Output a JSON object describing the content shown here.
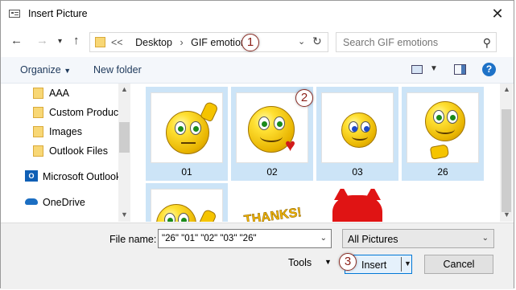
{
  "window": {
    "title": "Insert Picture"
  },
  "nav": {
    "breadcrumb": [
      "Desktop",
      "GIF emotions"
    ],
    "overflow": "<<",
    "search_placeholder": "Search GIF emotions"
  },
  "toolbar": {
    "organize_label": "Organize",
    "new_folder_label": "New folder"
  },
  "sidebar": {
    "items": [
      {
        "label": "AAA",
        "icon": "folder-icon"
      },
      {
        "label": "Custom Product",
        "icon": "folder-icon"
      },
      {
        "label": "Images",
        "icon": "folder-icon"
      },
      {
        "label": "Outlook Files",
        "icon": "folder-icon"
      },
      {
        "label": "Microsoft Outlook",
        "icon": "outlook-icon"
      },
      {
        "label": "OneDrive",
        "icon": "onedrive-icon"
      }
    ]
  },
  "files": [
    {
      "name": "01",
      "selected": true
    },
    {
      "name": "02",
      "selected": true
    },
    {
      "name": "03",
      "selected": true
    },
    {
      "name": "26",
      "selected": true
    },
    {
      "name": "",
      "selected": true
    },
    {
      "name": "",
      "selected": false
    },
    {
      "name": "",
      "selected": false
    }
  ],
  "footer": {
    "file_name_label": "File name:",
    "file_name_value": "\"26\" \"01\" \"02\" \"03\" \"26\"",
    "file_type": "All Pictures",
    "tools_label": "Tools",
    "insert_label": "Insert",
    "cancel_label": "Cancel"
  },
  "annotations": [
    "1",
    "2",
    "3"
  ],
  "colors": {
    "selection": "#cce4f7",
    "accent": "#0078d7",
    "badge": "#8b1e16"
  }
}
